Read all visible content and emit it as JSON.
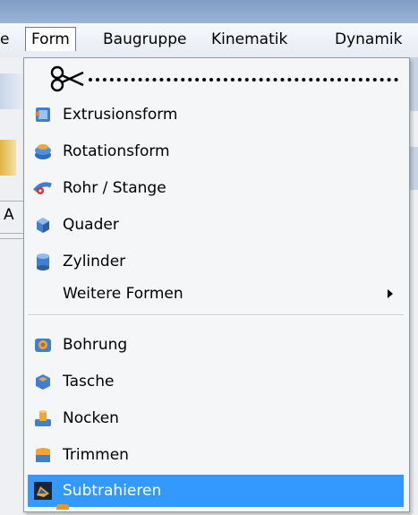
{
  "menubar": {
    "items": [
      {
        "label": "e",
        "active": false
      },
      {
        "label": "Form",
        "active": true
      },
      {
        "label": "Baugruppe",
        "active": false
      },
      {
        "label": "Kinematik",
        "active": false
      },
      {
        "label": "Dynamik",
        "active": false
      }
    ]
  },
  "menu": {
    "cut_icon": "scissors-icon",
    "items": [
      {
        "label": "Extrusionsform",
        "icon": "extrusion-icon"
      },
      {
        "label": "Rotationsform",
        "icon": "revolve-icon"
      },
      {
        "label": "Rohr / Stange",
        "icon": "pipe-icon"
      },
      {
        "label": "Quader",
        "icon": "box-icon"
      },
      {
        "label": "Zylinder",
        "icon": "cylinder-icon"
      },
      {
        "label": "Weitere Formen",
        "icon": "",
        "submenu": true
      }
    ],
    "feature_items": [
      {
        "label": "Bohrung",
        "icon": "hole-icon"
      },
      {
        "label": "Tasche",
        "icon": "pocket-icon"
      },
      {
        "label": "Nocken",
        "icon": "boss-icon"
      },
      {
        "label": "Trimmen",
        "icon": "trim-icon"
      },
      {
        "label": "Subtrahieren",
        "icon": "subtract-icon",
        "selected": true
      }
    ]
  },
  "background": {
    "left_label": "A"
  },
  "colors": {
    "selection": "#3399ff",
    "menu_bg": "#f5f6f7",
    "menu_border": "#8e9aa8"
  }
}
